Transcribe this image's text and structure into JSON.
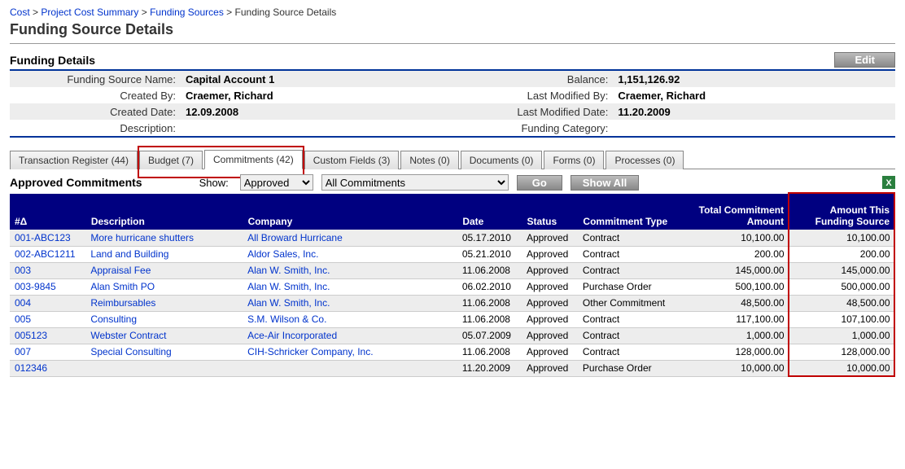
{
  "breadcrumb": {
    "cost": "Cost",
    "summary": "Project Cost Summary",
    "funding": "Funding Sources",
    "details": "Funding Source Details"
  },
  "page_title": "Funding Source Details",
  "section": {
    "title": "Funding Details",
    "edit": "Edit"
  },
  "details": {
    "name_label": "Funding Source Name:",
    "name_value": "Capital Account 1",
    "balance_label": "Balance:",
    "balance_value": "1,151,126.92",
    "created_by_label": "Created By:",
    "created_by_value": "Craemer, Richard",
    "modified_by_label": "Last Modified By:",
    "modified_by_value": "Craemer, Richard",
    "created_date_label": "Created Date:",
    "created_date_value": "12.09.2008",
    "modified_date_label": "Last Modified Date:",
    "modified_date_value": "11.20.2009",
    "description_label": "Description:",
    "description_value": "",
    "category_label": "Funding Category:",
    "category_value": ""
  },
  "tabs": {
    "t0": "Transaction Register (44)",
    "t1": "Budget (7)",
    "t2": "Commitments (42)",
    "t3": "Custom Fields (3)",
    "t4": "Notes (0)",
    "t5": "Documents (0)",
    "t6": "Forms (0)",
    "t7": "Processes (0)"
  },
  "filter": {
    "approved_label": "Approved Commitments",
    "show_label": "Show:",
    "show_value": "Approved",
    "all_value": "All Commitments",
    "go": "Go",
    "show_all": "Show All"
  },
  "headers": {
    "num": "#Δ",
    "desc": "Description",
    "company": "Company",
    "date": "Date",
    "status": "Status",
    "type": "Commitment Type",
    "total": "Total Commitment Amount",
    "amount": "Amount This Funding Source"
  },
  "rows": [
    {
      "num": "001-ABC123",
      "desc": "More hurricane shutters",
      "company": "All Broward Hurricane",
      "date": "05.17.2010",
      "status": "Approved",
      "type": "Contract",
      "total": "10,100.00",
      "amount": "10,100.00"
    },
    {
      "num": "002-ABC1211",
      "desc": "Land and Building",
      "company": "Aldor Sales, Inc.",
      "date": "05.21.2010",
      "status": "Approved",
      "type": "Contract",
      "total": "200.00",
      "amount": "200.00"
    },
    {
      "num": "003",
      "desc": "Appraisal Fee",
      "company": "Alan W. Smith, Inc.",
      "date": "11.06.2008",
      "status": "Approved",
      "type": "Contract",
      "total": "145,000.00",
      "amount": "145,000.00"
    },
    {
      "num": "003-9845",
      "desc": "Alan Smith PO",
      "company": "Alan W. Smith, Inc.",
      "date": "06.02.2010",
      "status": "Approved",
      "type": "Purchase Order",
      "total": "500,100.00",
      "amount": "500,000.00"
    },
    {
      "num": "004",
      "desc": "Reimbursables",
      "company": "Alan W. Smith, Inc.",
      "date": "11.06.2008",
      "status": "Approved",
      "type": "Other Commitment",
      "total": "48,500.00",
      "amount": "48,500.00"
    },
    {
      "num": "005",
      "desc": "Consulting",
      "company": "S.M. Wilson & Co.",
      "date": "11.06.2008",
      "status": "Approved",
      "type": "Contract",
      "total": "117,100.00",
      "amount": "107,100.00"
    },
    {
      "num": "005123",
      "desc": "Webster Contract",
      "company": "Ace-Air Incorporated",
      "date": "05.07.2009",
      "status": "Approved",
      "type": "Contract",
      "total": "1,000.00",
      "amount": "1,000.00"
    },
    {
      "num": "007",
      "desc": "Special Consulting",
      "company": "CIH-Schricker Company, Inc.",
      "date": "11.06.2008",
      "status": "Approved",
      "type": "Contract",
      "total": "128,000.00",
      "amount": "128,000.00"
    },
    {
      "num": "012346",
      "desc": "",
      "company": "",
      "date": "11.20.2009",
      "status": "Approved",
      "type": "Purchase Order",
      "total": "10,000.00",
      "amount": "10,000.00"
    }
  ]
}
